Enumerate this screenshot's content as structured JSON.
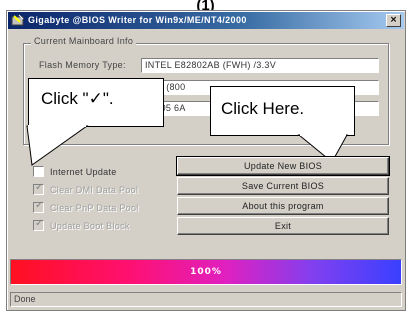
{
  "caption": "(1)",
  "window": {
    "title": "Gigabyte @BIOS Writer for Win9x/ME/NT4/2000",
    "close_label": "×"
  },
  "mainboard_info": {
    "group_title": "Current Mainboard Info",
    "flash_memory_label": "Flash Memory Type:",
    "flash_memory_value": "INTEL E82802AB (FWH) /3.3V",
    "bios_line1_partial": "rds (800",
    "bios_line2_partial": "0005 6A"
  },
  "callouts": {
    "left_text": "Click \"✓\".",
    "right_text": "Click Here."
  },
  "options": [
    {
      "label": "Internet Update",
      "checked": false,
      "enabled": true
    },
    {
      "label": "Clear DMI Data Pool",
      "checked": true,
      "enabled": false
    },
    {
      "label": "Clear PnP Data Pool",
      "checked": true,
      "enabled": false
    },
    {
      "label": "Update Boot Block",
      "checked": true,
      "enabled": false
    }
  ],
  "buttons": {
    "update_bios": "Update New BIOS",
    "save_bios": "Save Current BIOS",
    "about": "About this program",
    "exit": "Exit"
  },
  "progress": {
    "text": "100%",
    "value": 1.0
  },
  "status": "Done",
  "colors": {
    "title_bar": "#0a246a",
    "progress_start": "#ff1020",
    "progress_end": "#3a40ff",
    "window_face": "#d4d0c8"
  }
}
